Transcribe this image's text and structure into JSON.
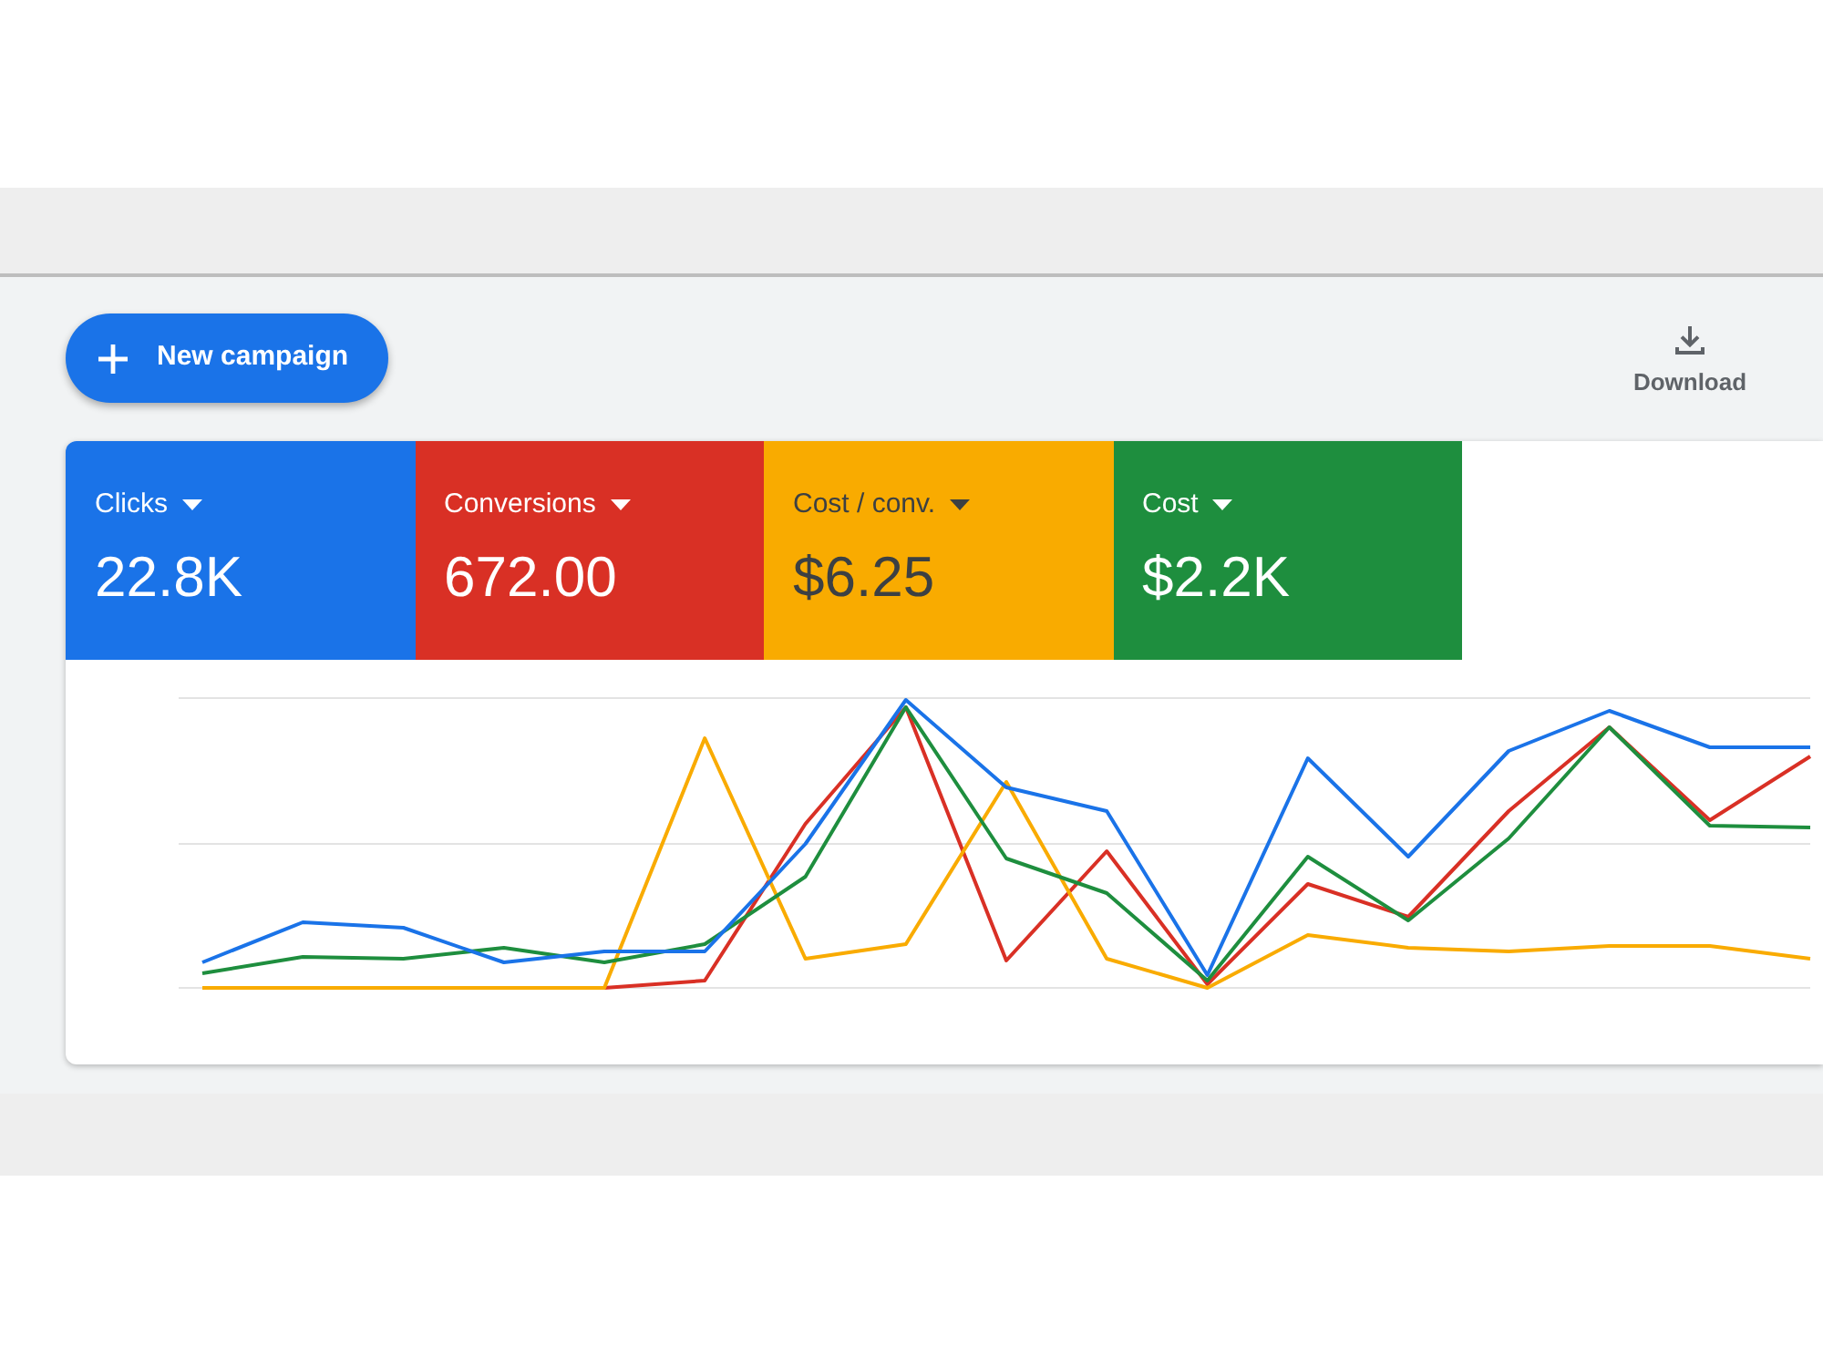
{
  "toolbar": {
    "new_campaign_button": {
      "label": "New campaign"
    },
    "download_button": {
      "label": "Download"
    }
  },
  "metrics": [
    {
      "label": "Clicks",
      "value": "22.8K",
      "color": "#1a73e8"
    },
    {
      "label": "Conversions",
      "value": "672.00",
      "color": "#d93025"
    },
    {
      "label": "Cost / conv.",
      "value": "$6.25",
      "color": "#f9ab00"
    },
    {
      "label": "Cost",
      "value": "$2.2K",
      "color": "#1e8e3e"
    }
  ]
}
